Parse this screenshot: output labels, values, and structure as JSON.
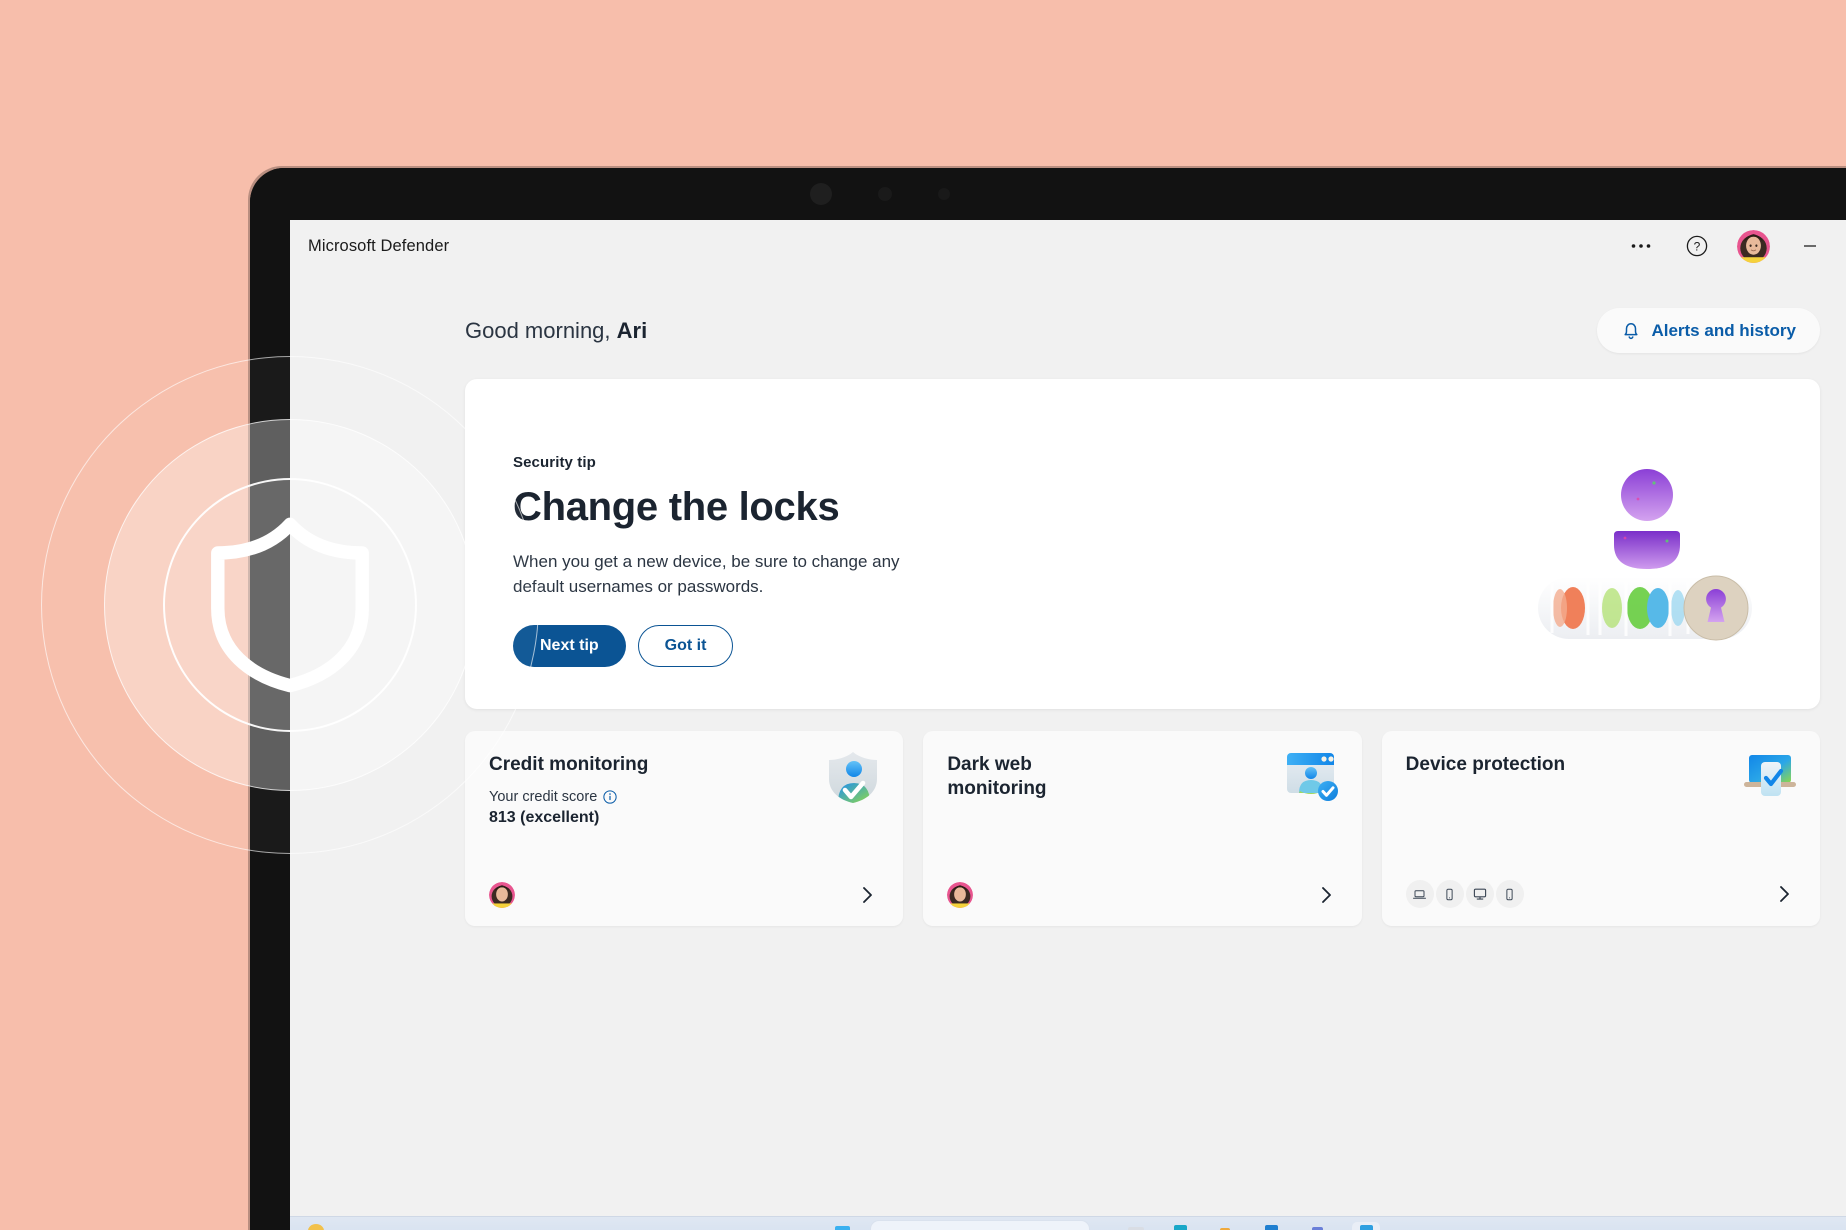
{
  "background": {
    "color": "#f7beab"
  },
  "decor": {
    "shield_icon": "shield-icon",
    "rings": [
      "ring-outer",
      "ring-mid",
      "ring-inner"
    ]
  },
  "window": {
    "title": "Microsoft Defender",
    "titlebar_actions": [
      {
        "name": "more-options-button",
        "icon": "ellipsis-icon",
        "label": "···"
      },
      {
        "name": "help-button",
        "icon": "help-circle-icon",
        "label": "?"
      },
      {
        "name": "account-avatar",
        "icon": "avatar-icon",
        "label": ""
      },
      {
        "name": "minimize-button",
        "icon": "minimize-icon",
        "label": "—"
      },
      {
        "name": "maximize-button",
        "icon": "maximize-icon",
        "label": "□"
      },
      {
        "name": "close-button",
        "icon": "close-icon",
        "label": "✕"
      }
    ]
  },
  "header": {
    "greeting_prefix": "Good morning, ",
    "greeting_name": "Ari",
    "alerts_label": "Alerts and history",
    "alerts_icon": "bell-icon"
  },
  "security_tip": {
    "eyebrow": "Security tip",
    "heading": "Change the locks",
    "description": "When you get a new device, be sure to change any default usernames or passwords.",
    "primary_button": "Next tip",
    "secondary_button": "Got it",
    "illustration": "password-keyhole-illustration",
    "primary_color": "#0b5494"
  },
  "cards": [
    {
      "name": "credit-monitoring",
      "title": "Credit monitoring",
      "subtitle": "Your credit score",
      "info_icon": "info-icon",
      "value": "813 (excellent)",
      "icon": "shield-person-icon",
      "footer_type": "avatar",
      "chevron_icon": "chevron-right-icon"
    },
    {
      "name": "dark-web-monitoring",
      "title": "Dark web monitoring",
      "subtitle": "",
      "info_icon": "",
      "value": "",
      "icon": "browser-person-check-icon",
      "footer_type": "avatar",
      "chevron_icon": "chevron-right-icon"
    },
    {
      "name": "device-protection",
      "title": "Device protection",
      "subtitle": "",
      "info_icon": "",
      "value": "",
      "icon": "laptop-phone-check-icon",
      "footer_type": "devices",
      "devices": [
        "laptop-icon",
        "phone-icon",
        "monitor-icon",
        "phone-icon"
      ],
      "chevron_icon": "chevron-right-icon"
    }
  ],
  "colors": {
    "accent_blue": "#0b5494",
    "link_blue": "#0a5ca8",
    "app_bg": "#f1f1f1",
    "card_bg": "#ffffff",
    "mini_card_bg": "#fafafa",
    "text_dark": "#1b2430"
  }
}
